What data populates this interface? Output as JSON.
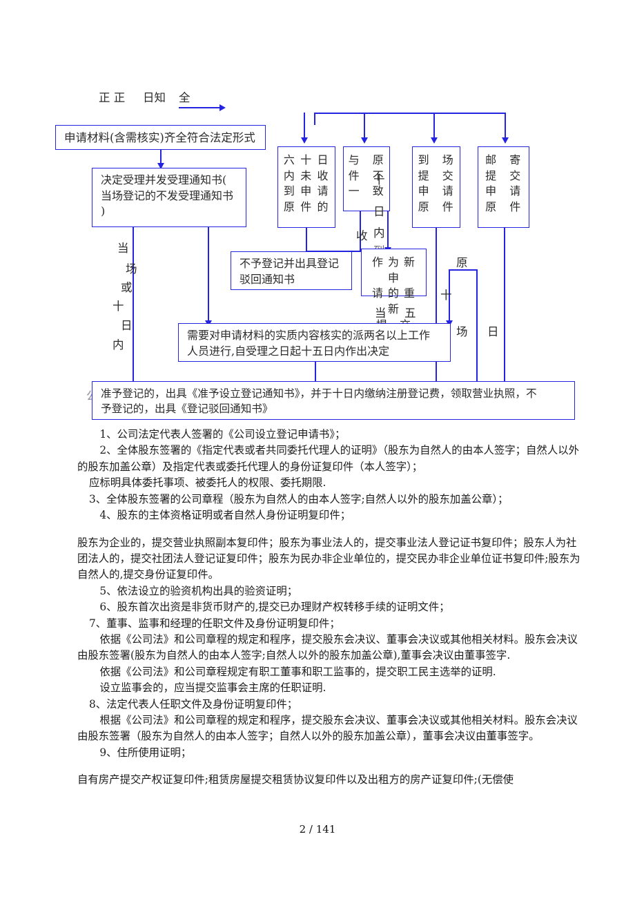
{
  "page": {
    "footer": "2 / 141",
    "accent_color": "#2424e0",
    "text_color": "#1d1d1d",
    "background": "#ffffff"
  },
  "header_marks": {
    "mark1": "正 正",
    "mark2": "日知",
    "mark3": "全"
  },
  "flowchart": {
    "nodes": {
      "apply_material": "申请材料(含需核实)齐全符合法定形式",
      "accept_decision": "决定受理并发受理通知书(\n当场登记的不发受理通知书\n)",
      "not_received_60d": "六 十 日\n内 未 收\n到 申 请\n原 件 的",
      "not_match_original": "与　原\n件　不\n一　致",
      "onsite_submit": "到　场\n提　交\n申　请\n原　件",
      "mail_submit": "邮　寄\n提　交\n申　请\n原　件",
      "reject_register": "不予登记并出具登记\n驳回通知书",
      "resubmit_as_new": "作 为 新 申\n请 的 重 新\n提　交",
      "verify_substance": "需要对申请材料的实质内容核实的派两名以上工作\n人员进行,自受理之日起十五日内作出决定",
      "final_decision": "准予登记的，出具《准予设立登记通知书》，并于十日内缴纳注册登记费，领取营业执照，不\n予登记的，出具《登记驳回通知书》"
    },
    "labels": {
      "onsite_or_ten_days": [
        "当",
        "场",
        "或",
        "十",
        "日",
        "内"
      ],
      "ten_days_arrive": [
        "十",
        "日",
        "内",
        "到"
      ],
      "received": "收",
      "onsite_right": "当",
      "five": "五",
      "original": "原",
      "ten_right": "十",
      "site_right": "场",
      "day_right": "日",
      "faint_gong": "公"
    }
  },
  "body": {
    "paragraphs": [
      {
        "indent": "ind2",
        "gap": false,
        "text": "1、公司法定代表人签署的《公司设立登记申请书》；"
      },
      {
        "indent": "ind2",
        "gap": false,
        "text": "2、全体股东签署的《指定代表或者共同委托代理人的证明》（股东为自然人的由本人签字；自然人以外的股东加盖公章）及指定代表或委托代理人的身份证复印件（本人签字）；"
      },
      {
        "indent": "ind1",
        "gap": false,
        "text": "应标明具体委托事项、被委托人的权限、委托期限."
      },
      {
        "indent": "ind1",
        "gap": false,
        "text": "3、全体股东签署的公司章程（股东为自然人的由本人签字;自然人以外的股东加盖公章）；"
      },
      {
        "indent": "ind2",
        "gap": false,
        "text": "4、股东的主体资格证明或者自然人身份证明复印件；"
      },
      {
        "indent": "ind0",
        "gap": true,
        "text": "股东为企业的，提交营业执照副本复印件；股东为事业法人的，提交事业法人登记证书复印件；股东人为社团法人的，提交社团法人登记证复印件；股东为民办非企业单位的，提交民办非企业单位证书复印件;股东为自然人的,提交身份证复印件。"
      },
      {
        "indent": "ind2",
        "gap": false,
        "text": "5、依法设立的验资机构出具的验资证明；"
      },
      {
        "indent": "ind2",
        "gap": false,
        "text": "6、股东首次出资是非货币财产的,提交已办理财产权转移手续的证明文件；"
      },
      {
        "indent": "ind1",
        "gap": false,
        "text": "7、董事、监事和经理的任职文件及身份证明复印件；"
      },
      {
        "indent": "ind2",
        "gap": false,
        "text": "依据《公司法》和公司章程的规定和程序，提交股东会决议、董事会决议或其他相关材料。股东会决议由股东签署(股东为自然人的由本人签字;自然人以外的股东加盖公章),董事会决议由董事签字."
      },
      {
        "indent": "ind2",
        "gap": false,
        "text": "依据《公司法》和公司章程规定有职工董事和职工监事的，提交职工民主选举的证明."
      },
      {
        "indent": "ind2",
        "gap": false,
        "text": "设立监事会的，应当提交监事会主席的任职证明."
      },
      {
        "indent": "ind1",
        "gap": false,
        "text": "8、法定代表人任职文件及身份证明复印件；"
      },
      {
        "indent": "ind2",
        "gap": false,
        "text": "根据《公司法》和公司章程的规定和程序，提交股东会决议、董事会决议或其他相关材料。股东会决议由股东签署（股东为自然人的由本人签字；自然人以外的股东加盖公章），董事会决议由董事签字。"
      },
      {
        "indent": "ind2",
        "gap": false,
        "text": "9、住所使用证明；"
      },
      {
        "indent": "ind0",
        "gap": true,
        "text": "自有房产提交产权证复印件;租赁房屋提交租赁协议复印件以及出租方的房产证复印件;(无偿使"
      }
    ]
  }
}
